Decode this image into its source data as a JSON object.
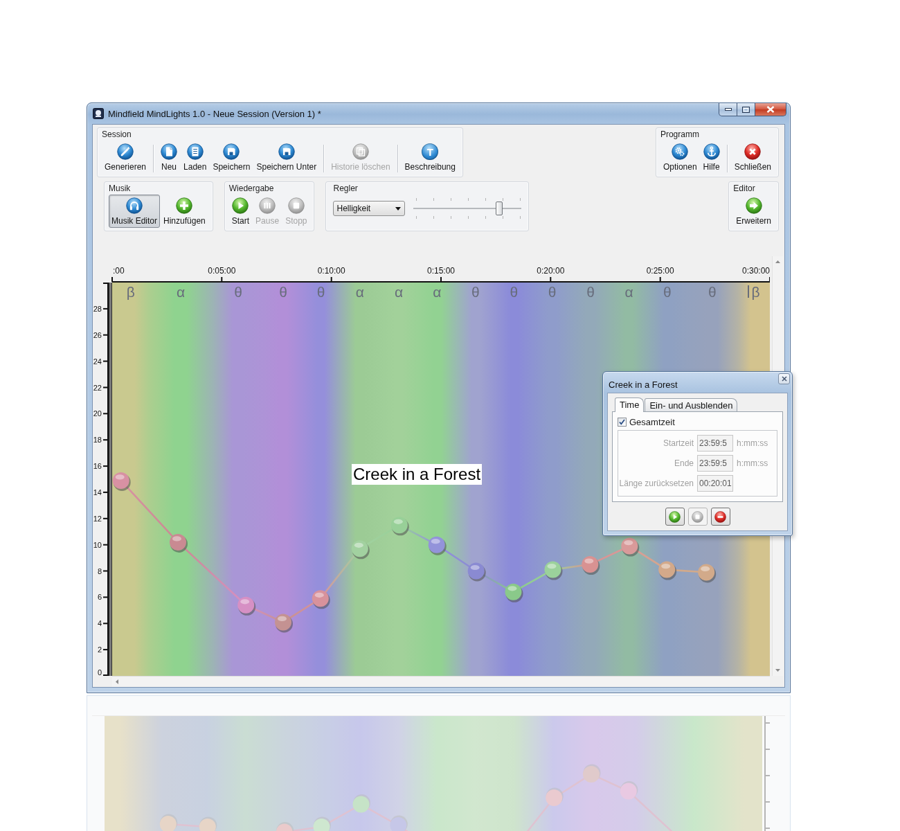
{
  "window": {
    "title": "Mindfield MindLights 1.0 - Neue Session (Version 1) *"
  },
  "ribbon": {
    "session": {
      "title": "Session",
      "sections": [
        {
          "buttons": [
            {
              "label": "Generieren",
              "kind": "generate",
              "disabled": false
            }
          ]
        },
        {
          "buttons": [
            {
              "label": "Neu",
              "kind": "new",
              "disabled": false
            },
            {
              "label": "Laden",
              "kind": "load",
              "disabled": false
            },
            {
              "label": "Speichern",
              "kind": "save",
              "disabled": false
            },
            {
              "label": "Speichern Unter",
              "kind": "save_as",
              "disabled": false
            }
          ]
        },
        {
          "buttons": [
            {
              "label": "Historie löschen",
              "kind": "clear_history",
              "disabled": true
            }
          ]
        },
        {
          "buttons": [
            {
              "label": "Beschreibung",
              "kind": "describe",
              "glyph": "T",
              "disabled": false
            }
          ]
        }
      ]
    },
    "musik": {
      "title": "Musik",
      "buttons": [
        {
          "label": "Musik Editor",
          "kind": "music_editor",
          "pressed": true
        },
        {
          "label": "Hinzufügen",
          "kind": "add",
          "pressed": false
        }
      ]
    },
    "wiedergabe": {
      "title": "Wiedergabe",
      "buttons": [
        {
          "label": "Start",
          "kind": "play",
          "disabled": false
        },
        {
          "label": "Pause",
          "kind": "pause",
          "disabled": true
        },
        {
          "label": "Stopp",
          "kind": "stop",
          "disabled": true
        }
      ]
    },
    "regler": {
      "title": "Regler",
      "dropdown": {
        "value": "Helligkeit"
      },
      "slider": {
        "level": 0.81
      }
    },
    "programm": {
      "title": "Programm",
      "sections": [
        {
          "buttons": [
            {
              "label": "Optionen",
              "kind": "options"
            },
            {
              "label": "Hilfe",
              "kind": "help"
            }
          ]
        },
        {
          "buttons": [
            {
              "label": "Schließen",
              "kind": "close"
            }
          ]
        }
      ]
    },
    "editor": {
      "title": "Editor",
      "buttons": [
        {
          "label": "Erweitern",
          "kind": "expand"
        }
      ]
    }
  },
  "timeline": {
    "bands": [
      {
        "label": "β",
        "color": "#c9c98f"
      },
      {
        "label": "α",
        "color": "#8fd38f"
      },
      {
        "label": "θ",
        "color": "#a996d6"
      },
      {
        "label": "θ",
        "color": "#b28fd8"
      },
      {
        "label": "θ",
        "color": "#958fdb"
      },
      {
        "label": "α",
        "color": "#9ccb95"
      },
      {
        "label": "α",
        "color": "#a2d19a"
      },
      {
        "label": "α",
        "color": "#92d292"
      },
      {
        "label": "θ",
        "color": "#a0a3cf"
      },
      {
        "label": "θ",
        "color": "#8b8bd9"
      },
      {
        "label": "θ",
        "color": "#8f9ccb"
      },
      {
        "label": "θ",
        "color": "#93a9b9"
      },
      {
        "label": "α",
        "color": "#92bba3"
      },
      {
        "label": "θ",
        "color": "#8fa1c2"
      },
      {
        "label": "θ",
        "color": "#97a2bc"
      },
      {
        "label": "β",
        "color": "#d3c38e"
      }
    ],
    "chart_data": {
      "type": "line",
      "x": [
        0.4,
        3,
        6.1,
        7.8,
        9.5,
        11.3,
        13.1,
        14.8,
        16.6,
        18.3,
        20.1,
        21.8,
        23.6,
        25.3,
        27.1
      ],
      "series": [
        {
          "marker": true,
          "values": [
            14.9,
            10.2,
            5.4,
            4.1,
            5.9,
            9.7,
            11.5,
            10,
            8,
            6.4,
            8.1,
            8.5,
            9.9,
            8.1,
            7.9
          ]
        }
      ],
      "xlim": [
        0,
        30
      ],
      "ylim": [
        0,
        30
      ],
      "xticks": [
        {
          "value": 0,
          "label": ":00"
        },
        {
          "value": 5,
          "label": "0:05:00"
        },
        {
          "value": 10,
          "label": "0:10:00"
        },
        {
          "value": 15,
          "label": "0:15:00"
        },
        {
          "value": 20,
          "label": "0:20:00"
        },
        {
          "value": 25,
          "label": "0:25:00"
        },
        {
          "value": 30,
          "label": "0:30:00"
        }
      ],
      "yticks": [
        0,
        2,
        4,
        6,
        8,
        10,
        12,
        14,
        16,
        18,
        20,
        22,
        24,
        26,
        28
      ]
    },
    "points": [
      {
        "color": "#d891a3"
      },
      {
        "color": "#c98a92"
      },
      {
        "color": "#d690c4"
      },
      {
        "color": "#c49292"
      },
      {
        "color": "#d8929c"
      },
      {
        "color": "#a2d1a0"
      },
      {
        "color": "#98d098"
      },
      {
        "color": "#9393da"
      },
      {
        "color": "#8a8ad2"
      },
      {
        "color": "#8ac98a"
      },
      {
        "color": "#9bd19b"
      },
      {
        "color": "#d89292"
      },
      {
        "color": "#d99a9a"
      },
      {
        "color": "#d3a98a"
      },
      {
        "color": "#d2aa8a"
      }
    ],
    "caption": "Creek in a Forest"
  },
  "dialog": {
    "title": "Creek in a Forest",
    "tabs": [
      {
        "label": "Time",
        "selected": true
      },
      {
        "label": "Ein- und Ausblenden",
        "selected": false
      }
    ],
    "checkbox": {
      "label": "Gesamtzeit",
      "checked": true
    },
    "fields": [
      {
        "label": "Startzeit",
        "value": "23:59:5",
        "unit": "h:mm:ss",
        "disabled": true
      },
      {
        "label": "Ende",
        "value": "23:59:5",
        "unit": "h:mm:ss",
        "disabled": true
      },
      {
        "label": "Länge zurücksetzen",
        "value": "00:20:01",
        "disabled": true
      }
    ],
    "buttons": [
      {
        "kind": "play",
        "disabled": false
      },
      {
        "kind": "stop",
        "disabled": true
      },
      {
        "kind": "remove",
        "disabled": false
      }
    ]
  }
}
